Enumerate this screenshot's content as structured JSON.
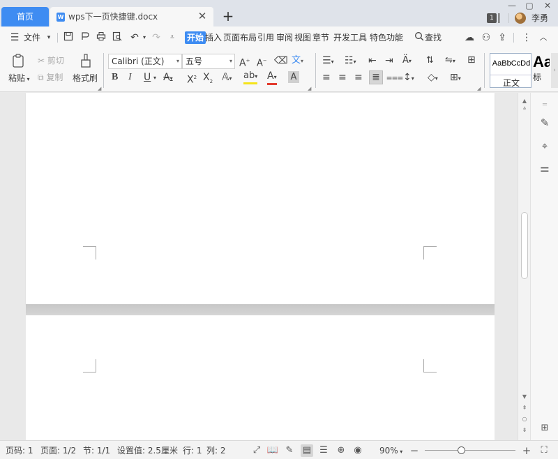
{
  "tabs": {
    "home_label": "首页",
    "doc_icon_letter": "W",
    "doc_title": "wps下一页快捷键.docx",
    "close_glyph": "✕",
    "new_tab_glyph": "+"
  },
  "window": {
    "restore_glyph": "▢",
    "minimize_glyph": "—",
    "badge": "1",
    "user_name": "李勇"
  },
  "menu": {
    "file_label": "文件",
    "items": [
      "开始",
      "插入",
      "页面布局",
      "引用",
      "审阅",
      "视图",
      "章节",
      "开发工具",
      "特色功能"
    ],
    "active_item": "开始",
    "search_label": "查找"
  },
  "ribbon": {
    "paste_label": "粘贴",
    "cut_label": "剪切",
    "copy_label": "复制",
    "format_painter_label": "格式刷",
    "font_name": "Calibri (正文)",
    "font_size": "五号",
    "bold": "B",
    "italic": "I",
    "underline": "U",
    "style_sample": "AaBbCcDd",
    "style_name": "正文",
    "style2_sample": "Aa",
    "style2_name": "标"
  },
  "status": {
    "page_num": "页码: 1",
    "pages": "页面: 1/2",
    "section": "节: 1/1",
    "setting": "设置值: 2.5厘米",
    "row": "行: 1",
    "col": "列: 2",
    "zoom": "90%",
    "zoom_level": 0.4
  },
  "colors": {
    "accent": "#3e8cf2",
    "tabbar_bg": "#dfe3ea",
    "ribbon_bg": "#f7f7f7",
    "canvas_bg": "#e9e9e9"
  }
}
